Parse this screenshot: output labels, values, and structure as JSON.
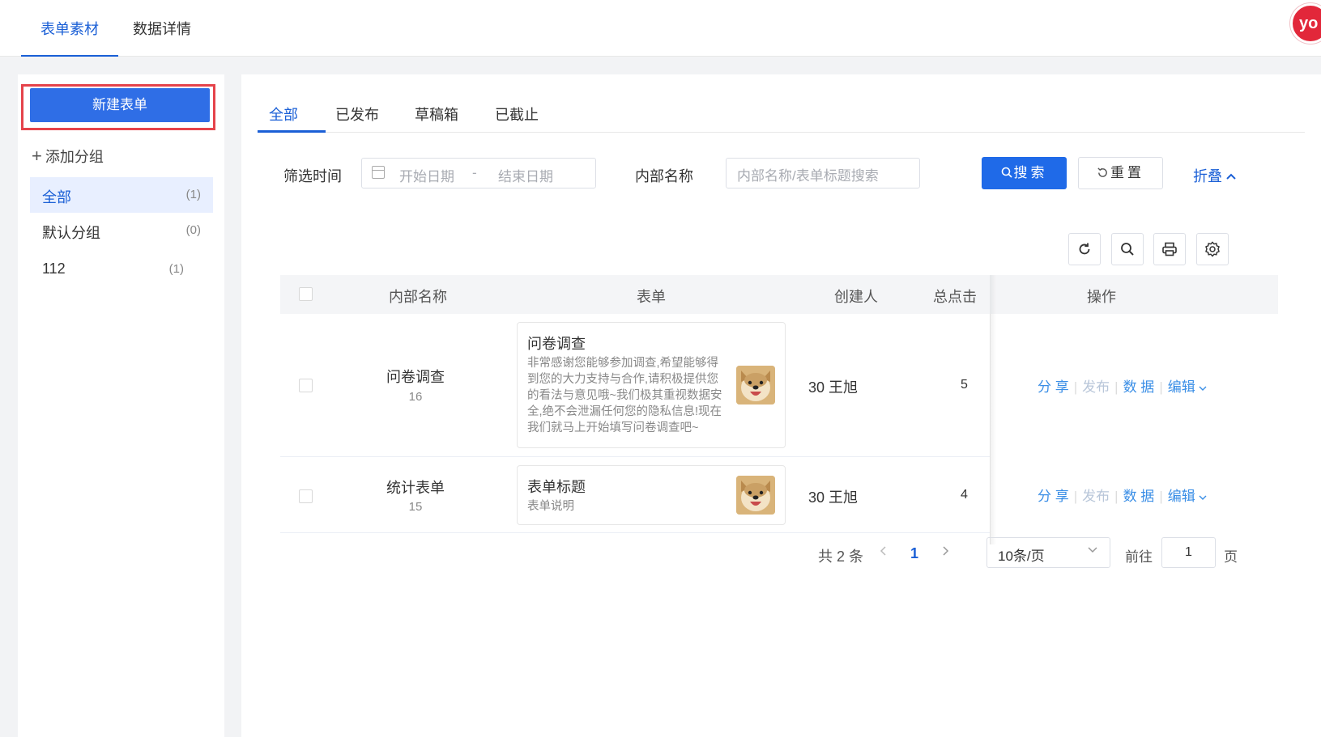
{
  "top_tabs": {
    "tab1": "表单素材",
    "tab2": "数据详情",
    "avatar_text": "yo"
  },
  "sidebar": {
    "new_form_label": "新建表单",
    "add_group_label": "添加分组",
    "groups": [
      {
        "label": "全部",
        "count": "(1)"
      },
      {
        "label": "默认分组",
        "count": "(0)"
      },
      {
        "label": "112",
        "count": "(1)"
      }
    ]
  },
  "main_tabs": [
    "全部",
    "已发布",
    "草稿箱",
    "已截止"
  ],
  "filters": {
    "time_label": "筛选时间",
    "start_placeholder": "开始日期",
    "date_separator": "-",
    "end_placeholder": "结束日期",
    "name_label": "内部名称",
    "name_placeholder": "内部名称/表单标题搜索",
    "search_label": "搜索",
    "reset_label": "重置",
    "collapse_label": "折叠"
  },
  "toolbar_icons": [
    "refresh-icon",
    "search-icon",
    "print-icon",
    "gear-icon"
  ],
  "table": {
    "headers": {
      "name": "内部名称",
      "form": "表单",
      "creator": "创建人",
      "clicks": "总点击",
      "actions": "操作"
    },
    "rows": [
      {
        "name": "问卷调查",
        "id": "16",
        "form_title": "问卷调查",
        "form_desc": "非常感谢您能够参加调查,希望能够得到您的大力支持与合作,请积极提供您的看法与意见哦~我们极其重视数据安全,绝不会泄漏任何您的隐私信息!现在我们就马上开始填写问卷调查吧~",
        "creator": "30 王旭",
        "clicks": "5"
      },
      {
        "name": "统计表单",
        "id": "15",
        "form_title": "表单标题",
        "form_desc": "表单说明",
        "creator": "30 王旭",
        "clicks": "4"
      }
    ],
    "actions": {
      "share": "分 享",
      "publish": "发布",
      "data": "数 据",
      "edit": "编辑"
    }
  },
  "pagination": {
    "total": "共 2 条",
    "current_page": "1",
    "page_size": "10条/页",
    "goto_label": "前往",
    "goto_value": "1",
    "page_label": "页"
  },
  "colors": {
    "primary": "#1f6ae8",
    "link": "#3a8ee6",
    "highlight_outline": "#e5434b"
  }
}
